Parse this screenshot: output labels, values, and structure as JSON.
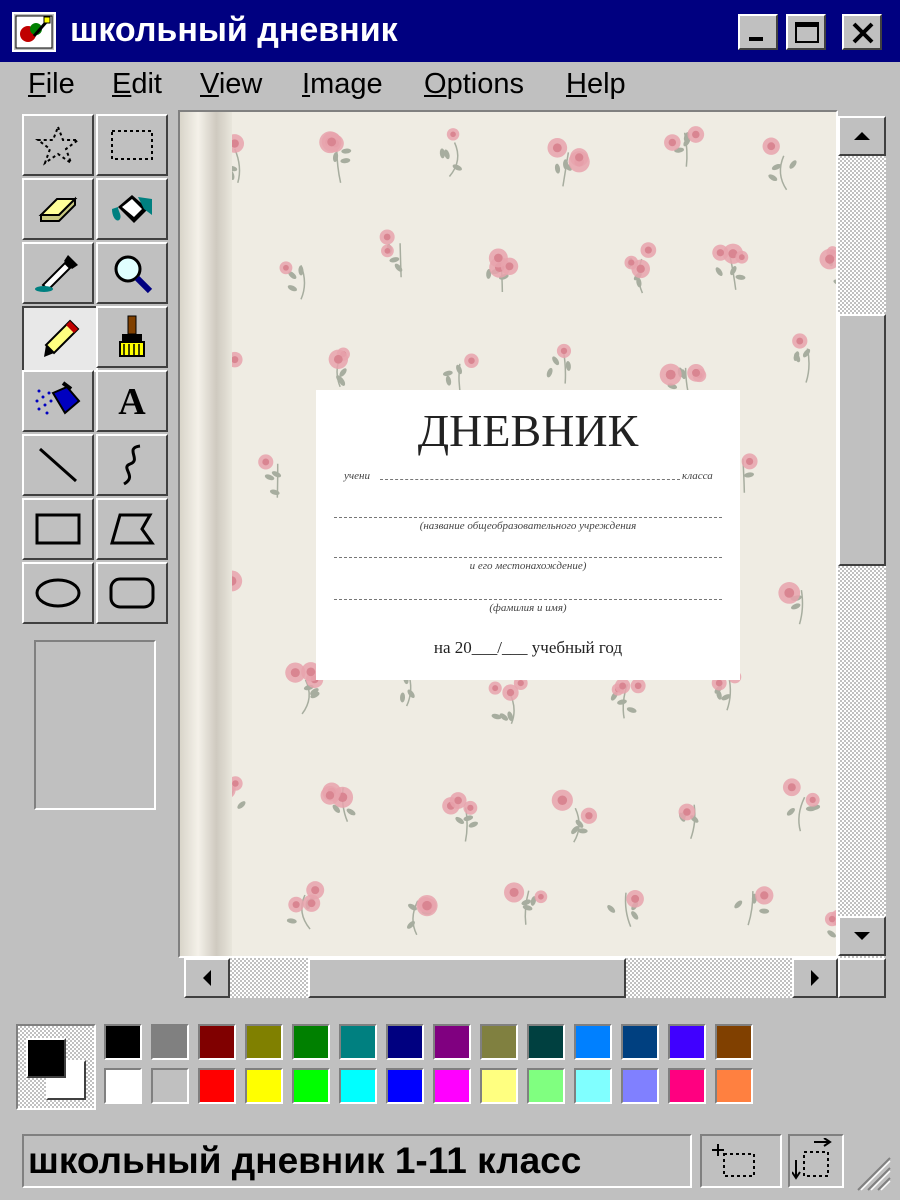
{
  "window": {
    "title": "школьный дневник"
  },
  "menu": {
    "items": [
      {
        "label": "File",
        "underline": "F",
        "rest": "ile"
      },
      {
        "label": "Edit",
        "underline": "E",
        "rest": "dit"
      },
      {
        "label": "View",
        "underline": "V",
        "rest": "iew"
      },
      {
        "label": "Image",
        "underline": "I",
        "rest": "mage"
      },
      {
        "label": "Options",
        "underline": "O",
        "rest": "ptions"
      },
      {
        "label": "Help",
        "underline": "H",
        "rest": "elp"
      }
    ]
  },
  "tools": [
    {
      "name": "free-form-select",
      "icon": "star-select-icon"
    },
    {
      "name": "rect-select",
      "icon": "rect-select-icon"
    },
    {
      "name": "eraser",
      "icon": "eraser-icon"
    },
    {
      "name": "fill",
      "icon": "paint-bucket-icon"
    },
    {
      "name": "pick-color",
      "icon": "eyedropper-icon"
    },
    {
      "name": "magnifier",
      "icon": "magnifier-icon"
    },
    {
      "name": "pencil",
      "icon": "pencil-icon",
      "active": true
    },
    {
      "name": "brush",
      "icon": "brush-icon"
    },
    {
      "name": "airbrush",
      "icon": "airbrush-icon"
    },
    {
      "name": "text",
      "icon": "text-icon",
      "glyph": "A"
    },
    {
      "name": "line",
      "icon": "line-icon"
    },
    {
      "name": "curve",
      "icon": "curve-icon"
    },
    {
      "name": "rectangle",
      "icon": "rectangle-icon"
    },
    {
      "name": "polygon",
      "icon": "polygon-icon"
    },
    {
      "name": "ellipse",
      "icon": "ellipse-icon"
    },
    {
      "name": "rounded-rectangle",
      "icon": "rounded-rect-icon"
    }
  ],
  "canvas": {
    "title": "ДНЕВНИК",
    "student_prefix": "учени",
    "class_suffix": "класса",
    "school_caption": "(название общеобразовательного учреждения",
    "location_caption": "и его местонахождение)",
    "name_caption": "(фамилия и имя)",
    "year_line": "на 20___/___ учебный год",
    "colors": {
      "background": "#efece3",
      "rose": "#e8a3ad",
      "leaf": "#a7ad9f"
    }
  },
  "palette": {
    "foreground": "#000000",
    "background": "#ffffff",
    "row1": [
      "#000000",
      "#808080",
      "#800000",
      "#808000",
      "#008000",
      "#008080",
      "#000080",
      "#800080",
      "#808040",
      "#004040",
      "#0080ff",
      "#004080",
      "#4000ff",
      "#804000"
    ],
    "row2": [
      "#ffffff",
      "#c0c0c0",
      "#ff0000",
      "#ffff00",
      "#00ff00",
      "#00ffff",
      "#0000ff",
      "#ff00ff",
      "#ffff80",
      "#80ff80",
      "#80ffff",
      "#8080ff",
      "#ff0080",
      "#ff8040"
    ]
  },
  "status": {
    "text": "школьный дневник 1-11 класс"
  }
}
